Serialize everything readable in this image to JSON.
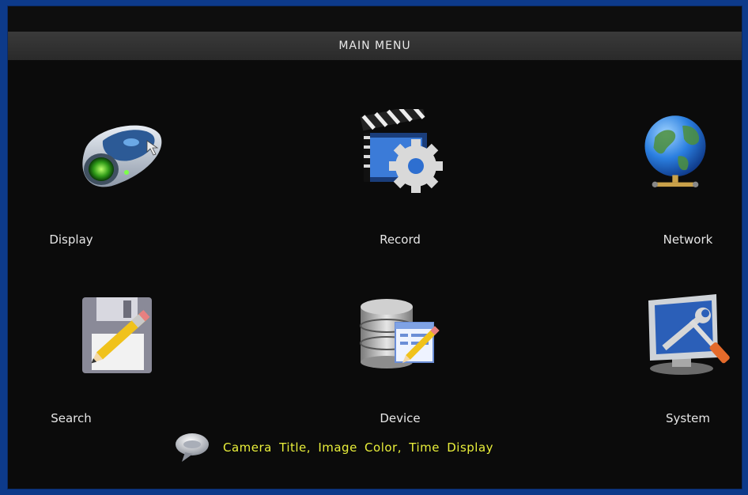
{
  "window": {
    "title": "MAIN MENU"
  },
  "menu": {
    "items": [
      {
        "id": "display",
        "label": "Display",
        "icon": "camera-icon"
      },
      {
        "id": "record",
        "label": "Record",
        "icon": "clapboard-gear-icon"
      },
      {
        "id": "network",
        "label": "Network",
        "icon": "globe-icon"
      },
      {
        "id": "search",
        "label": "Search",
        "icon": "floppy-pencil-icon"
      },
      {
        "id": "device",
        "label": "Device",
        "icon": "database-icon"
      },
      {
        "id": "system",
        "label": "System",
        "icon": "monitor-tools-icon"
      }
    ]
  },
  "hint": {
    "icon": "speech-bubble-icon",
    "text": "Camera Title, Image Color, Time Display"
  },
  "colors": {
    "frame": "#0d3a8a",
    "background": "#0b0b0b",
    "hint_text": "#e9ef3a"
  }
}
